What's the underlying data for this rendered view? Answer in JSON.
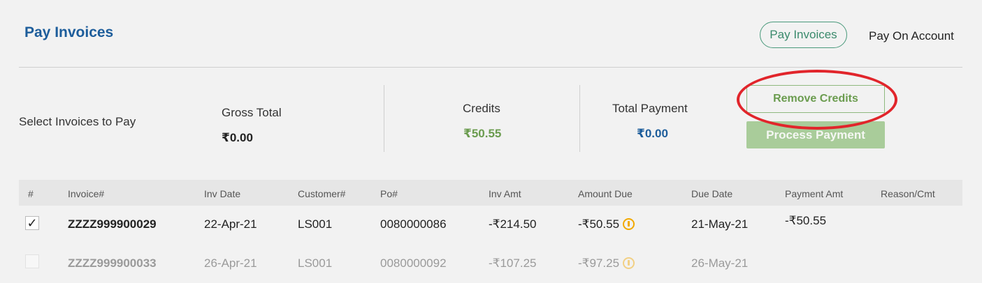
{
  "header": {
    "title": "Pay Invoices",
    "tabs": [
      {
        "label": "Pay Invoices",
        "active": true
      },
      {
        "label": "Pay On Account",
        "active": false
      }
    ]
  },
  "summary": {
    "select_label": "Select Invoices to Pay",
    "gross_total": {
      "label": "Gross Total",
      "value": "₹0.00"
    },
    "credits": {
      "label": "Credits",
      "value": "₹50.55"
    },
    "total_payment": {
      "label": "Total Payment",
      "value": "₹0.00"
    }
  },
  "actions": {
    "remove_credits": "Remove Credits",
    "process_payment": "Process Payment"
  },
  "table": {
    "columns": [
      "#",
      "Invoice#",
      "Inv Date",
      "Customer#",
      "Po#",
      "Inv Amt",
      "Amount Due",
      "Due Date",
      "Payment Amt",
      "Reason/Cmt"
    ],
    "rows": [
      {
        "checked": true,
        "check_mark": "✓",
        "invoice": "ZZZZ999900029",
        "inv_date": "22-Apr-21",
        "customer": "LS001",
        "po": "0080000086",
        "inv_amt": "-₹214.50",
        "amount_due": "-₹50.55",
        "due_date": "21-May-21",
        "payment_amt": "-₹50.55",
        "reason": ""
      },
      {
        "checked": false,
        "check_mark": "",
        "invoice": "ZZZZ999900033",
        "inv_date": "26-Apr-21",
        "customer": "LS001",
        "po": "0080000092",
        "inv_amt": "-₹107.25",
        "amount_due": "-₹97.25",
        "due_date": "26-May-21",
        "payment_amt": "",
        "reason": ""
      }
    ]
  },
  "colors": {
    "title": "#1d5d9b",
    "credits_value": "#6b9c4f",
    "total_payment_value": "#1d5d9b",
    "highlight": "#e1252b",
    "warning": "#f2a900"
  },
  "icons": {
    "warning": "warning-circle-icon"
  }
}
